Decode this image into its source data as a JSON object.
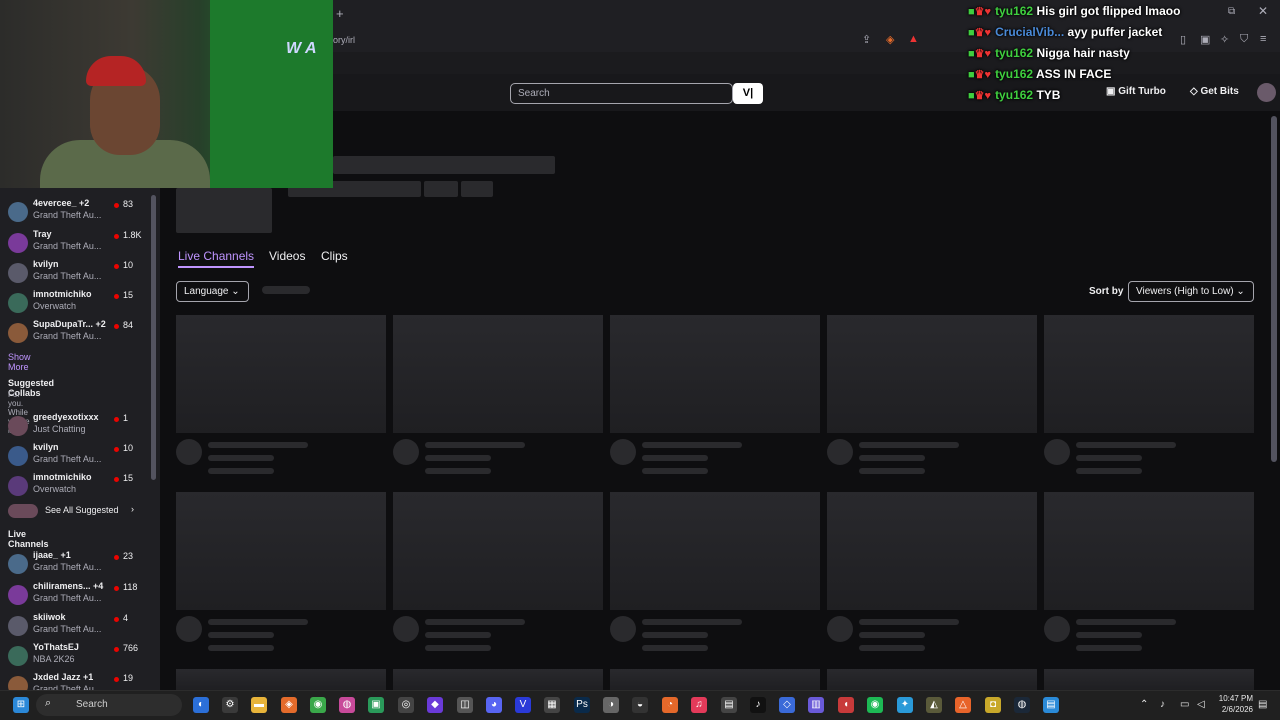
{
  "browser": {
    "new_tab_symbol": "+",
    "url_fragment": "ory/irl"
  },
  "topbar": {
    "search_placeholder": "Search",
    "search_button": "V|",
    "gift_turbo": "Gift Turbo",
    "get_bits": "Get Bits"
  },
  "webcam": {
    "wall_text": "W A"
  },
  "chat": [
    {
      "user": "tyu162",
      "message": "His girl got flipped lmaoo",
      "user_color": "green"
    },
    {
      "user": "CrucialVib...",
      "message": "ayy puffer jacket",
      "user_color": "blue"
    },
    {
      "user": "tyu162",
      "message": "Nigga hair nasty",
      "user_color": "green"
    },
    {
      "user": "tyu162",
      "message": "ASS IN FACE",
      "user_color": "green"
    },
    {
      "user": "tyu162",
      "message": "TYB",
      "user_color": "green"
    }
  ],
  "sidebar": {
    "followed": [
      {
        "name": "4evercee_ +2",
        "category": "Grand Theft Au...",
        "count": "83"
      },
      {
        "name": "Tray",
        "category": "Grand Theft Au...",
        "count": "1.8K"
      },
      {
        "name": "kvilyn",
        "category": "Grand Theft Au...",
        "count": "10"
      },
      {
        "name": "imnotmichiko",
        "category": "Overwatch",
        "count": "15"
      },
      {
        "name": "SupaDupaTr... +2",
        "category": "Grand Theft Au...",
        "count": "84"
      }
    ],
    "show_more": "Show More",
    "suggested_header": "Suggested Collabs",
    "suggested_sub": "For you. While you're live.",
    "suggested": [
      {
        "name": "greedyexotixxx",
        "category": "Just Chatting",
        "count": "1"
      },
      {
        "name": "kvilyn",
        "category": "Grand Theft Au...",
        "count": "10"
      },
      {
        "name": "imnotmichiko",
        "category": "Overwatch",
        "count": "15"
      }
    ],
    "see_all": "See All Suggested",
    "live_header": "Live Channels",
    "live": [
      {
        "name": "ijaae_ +1",
        "category": "Grand Theft Au...",
        "count": "23"
      },
      {
        "name": "chiliramens... +4",
        "category": "Grand Theft Au...",
        "count": "118"
      },
      {
        "name": "skiiwok",
        "category": "Grand Theft Au...",
        "count": "4"
      },
      {
        "name": "YoThatsEJ",
        "category": "NBA 2K26",
        "count": "766"
      },
      {
        "name": "Jxded Jazz +1",
        "category": "Grand Theft Au...",
        "count": "19"
      }
    ]
  },
  "main": {
    "tabs": [
      "Live Channels",
      "Videos",
      "Clips"
    ],
    "language_filter": "Language",
    "sort_label": "Sort by",
    "sort_value": "Viewers (High to Low)"
  },
  "taskbar": {
    "search": "Search",
    "time": "10:47 PM",
    "date": "2/6/2026"
  },
  "colors": {
    "accent": "#bf94ff",
    "live_red": "#eb0400",
    "chat_green": "#3fcf3f"
  }
}
